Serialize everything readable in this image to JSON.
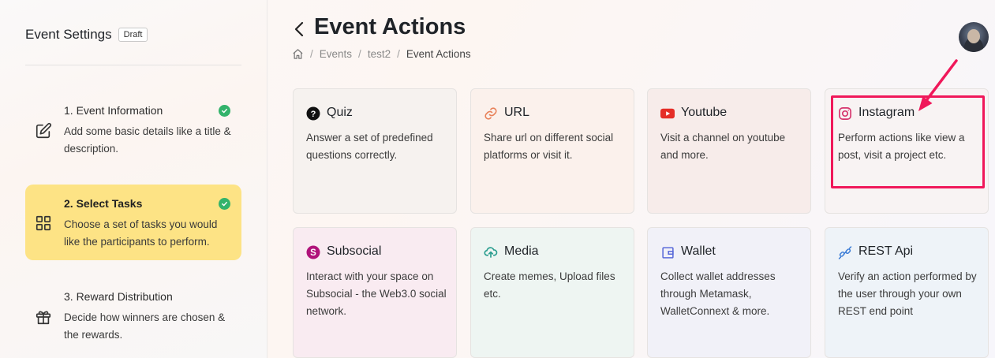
{
  "sidebar": {
    "title": "Event Settings",
    "badge": "Draft",
    "steps": [
      {
        "title": "1. Event Information",
        "description": "Add some basic details like a title & description.",
        "icon": "edit-icon",
        "completed": true,
        "active": false
      },
      {
        "title": "2. Select Tasks",
        "description": "Choose a set of tasks you would like the participants to perform.",
        "icon": "grid-icon",
        "completed": true,
        "active": true
      },
      {
        "title": "3. Reward Distribution",
        "description": "Decide how winners are chosen & the rewards.",
        "icon": "gift-icon",
        "completed": false,
        "active": false
      }
    ]
  },
  "header": {
    "title": "Event Actions",
    "breadcrumb": [
      "Events",
      "test2",
      "Event Actions"
    ]
  },
  "cards": [
    {
      "title": "Quiz",
      "description": "Answer a set of predefined questions correctly.",
      "icon": "question-circle-icon"
    },
    {
      "title": "URL",
      "description": "Share url on different social platforms or visit it.",
      "icon": "link-icon"
    },
    {
      "title": "Youtube",
      "description": "Visit a channel on youtube and more.",
      "icon": "youtube-icon"
    },
    {
      "title": "Instagram",
      "description": "Perform actions like view a post, visit a project etc.",
      "icon": "instagram-icon"
    },
    {
      "title": "Subsocial",
      "description": "Interact with your space on Subsocial - the Web3.0 social network.",
      "icon": "subsocial-icon"
    },
    {
      "title": "Media",
      "description": "Create memes, Upload files etc.",
      "icon": "cloud-upload-icon"
    },
    {
      "title": "Wallet",
      "description": "Collect wallet addresses through Metamask, WalletConnext & more.",
      "icon": "wallet-icon"
    },
    {
      "title": "REST Api",
      "description": "Verify an action performed by the user through your own REST end point",
      "icon": "api-icon"
    }
  ],
  "colors": {
    "active_step": "#fde385",
    "check": "#33b36b",
    "annotation": "#f0185a",
    "youtube": "#e52d27",
    "instagram": "#d6336c",
    "subsocial": "#b0127a",
    "media": "#2a9d8f",
    "wallet": "#5b6bd9",
    "api": "#3a7bd5",
    "url": "#e8825a"
  }
}
